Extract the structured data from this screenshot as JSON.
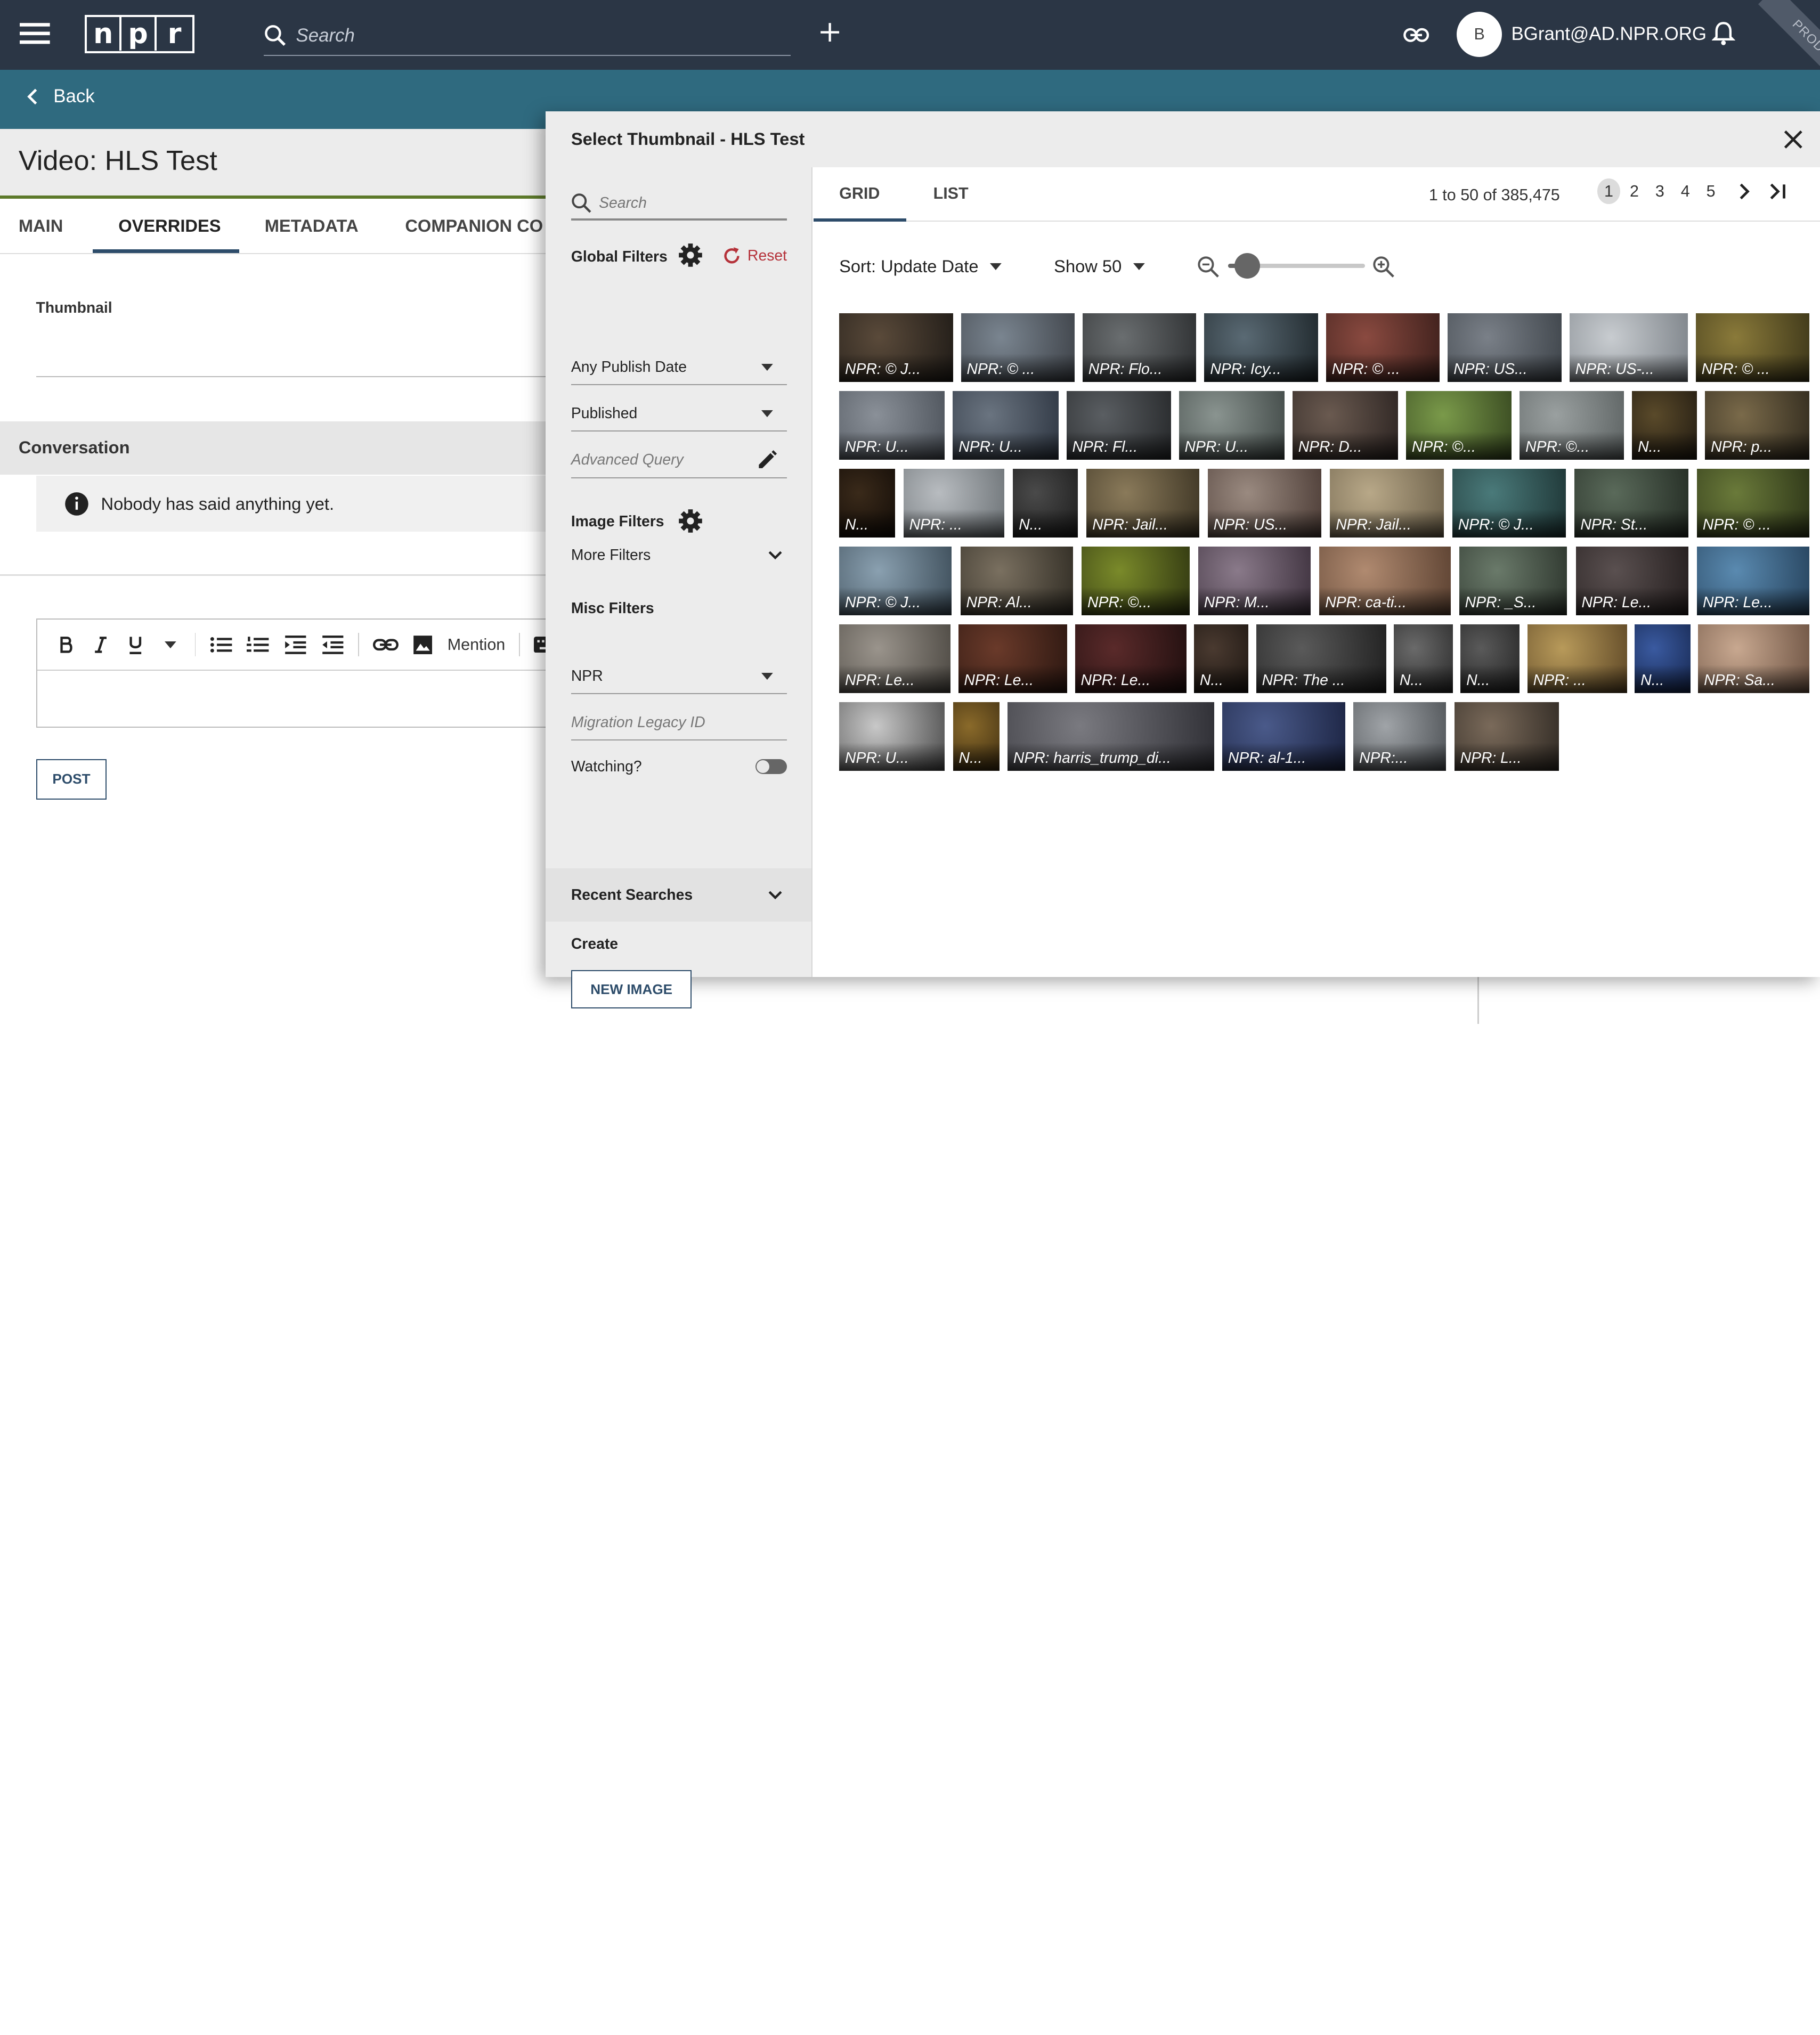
{
  "topbar": {
    "logo_letters": [
      "n",
      "p",
      "r"
    ],
    "search_placeholder": "Search",
    "avatar_initial": "B",
    "user_email": "BGrant@AD.NPR.ORG",
    "env_badge": "PROD",
    "bg_color": "#2b3645"
  },
  "backbar": {
    "back_label": "Back",
    "bg_color": "#2f6a7f"
  },
  "page": {
    "title": "Video: HLS Test",
    "tabs": [
      {
        "label": "MAIN"
      },
      {
        "label": "OVERRIDES",
        "active": true
      },
      {
        "label": "METADATA"
      },
      {
        "label": "COMPANION CO"
      }
    ],
    "thumbnail_label": "Thumbnail",
    "conversation_heading": "Conversation",
    "conversation_empty": "Nobody has said anything yet.",
    "editor_mention_label": "Mention",
    "post_label": "POST"
  },
  "modal": {
    "title": "Select Thumbnail - HLS Test",
    "filters": {
      "search_placeholder": "Search",
      "global_filters_heading": "Global Filters",
      "reset_label": "Reset",
      "publish_date_value": "Any Publish Date",
      "status_value": "Published",
      "advanced_query_placeholder": "Advanced Query",
      "image_filters_heading": "Image Filters",
      "more_filters_label": "More Filters",
      "misc_filters_heading": "Misc Filters",
      "source_value": "NPR",
      "migration_placeholder": "Migration Legacy ID",
      "watching_label": "Watching?",
      "watching_on": false,
      "recent_searches_label": "Recent Searches",
      "create_heading": "Create",
      "new_image_label": "NEW IMAGE"
    },
    "view_tabs": [
      {
        "label": "GRID",
        "active": true
      },
      {
        "label": "LIST"
      }
    ],
    "range_text": "1 to 50 of 385,475",
    "pages": [
      "1",
      "2",
      "3",
      "4",
      "5"
    ],
    "current_page": "1",
    "sort_label": "Sort: Update Date",
    "show_label": "Show 50",
    "zoom_level": 0.14,
    "accent_color": "#2d4c6a",
    "grid_rows": [
      [
        {
          "caption": "NPR: © J...",
          "c1": "#5a4a3a",
          "c2": "#1e1a16"
        },
        {
          "caption": "NPR: © ...",
          "c1": "#7a8590",
          "c2": "#3c4046"
        },
        {
          "caption": "NPR: Flo...",
          "c1": "#6a6e70",
          "c2": "#2a2c2e"
        },
        {
          "caption": "NPR: Icy...",
          "c1": "#5a6a74",
          "c2": "#1c2428"
        },
        {
          "caption": "NPR: © ...",
          "c1": "#8a4a40",
          "c2": "#3a1e1a"
        },
        {
          "caption": "NPR: US...",
          "c1": "#7a8088",
          "c2": "#3c4248"
        },
        {
          "caption": "NPR: US-...",
          "c1": "#c8ccd0",
          "c2": "#7a8086"
        },
        {
          "caption": "NPR: © ...",
          "c1": "#8a7a3a",
          "c2": "#3a3418"
        }
      ],
      [
        {
          "caption": "NPR: U...",
          "c1": "#8a9098",
          "c2": "#4a5058"
        },
        {
          "caption": "NPR: U...",
          "c1": "#6a7480",
          "c2": "#2c3440"
        },
        {
          "caption": "NPR: Fl...",
          "c1": "#5a5e62",
          "c2": "#242628"
        },
        {
          "caption": "NPR: U...",
          "c1": "#8a9490",
          "c2": "#3e4644"
        },
        {
          "caption": "NPR: D...",
          "c1": "#6a5a50",
          "c2": "#2a2220"
        },
        {
          "caption": "NPR: ©...",
          "c1": "#7a9a4a",
          "c2": "#34441e"
        },
        {
          "caption": "NPR: ©...",
          "c1": "#9aa0a0",
          "c2": "#5a6060"
        },
        {
          "caption": "N...",
          "c1": "#5a4a2a",
          "c2": "#1e1810"
        },
        {
          "caption": "NPR: p...",
          "c1": "#7a6a4a",
          "c2": "#2e281c"
        }
      ],
      [
        {
          "caption": "N...",
          "c1": "#3a2a1a",
          "c2": "#100a06"
        },
        {
          "caption": "NPR: ...",
          "c1": "#b8bcc0",
          "c2": "#6a7074"
        },
        {
          "caption": "N...",
          "c1": "#4a4a4a",
          "c2": "#1a1a1a"
        },
        {
          "caption": "NPR: Jail...",
          "c1": "#8a7a5a",
          "c2": "#3a3222"
        },
        {
          "caption": "NPR: US...",
          "c1": "#9a8a80",
          "c2": "#4a3a34"
        },
        {
          "caption": "NPR: Jail...",
          "c1": "#b8a888",
          "c2": "#6a5e48"
        },
        {
          "caption": "NPR: © J...",
          "c1": "#4a7a7a",
          "c2": "#1c3232"
        },
        {
          "caption": "NPR: St...",
          "c1": "#5a6a5a",
          "c2": "#222a22"
        },
        {
          "caption": "NPR: © ...",
          "c1": "#6a7a3a",
          "c2": "#2a3216"
        }
      ],
      [
        {
          "caption": "NPR: © J...",
          "c1": "#8aa0b0",
          "c2": "#3a4a56"
        },
        {
          "caption": "NPR: Al...",
          "c1": "#7a7060",
          "c2": "#2e2a22"
        },
        {
          "caption": "NPR: ©...",
          "c1": "#7a8a2a",
          "c2": "#2e3410"
        },
        {
          "caption": "NPR: M...",
          "c1": "#8a7a8a",
          "c2": "#3a2e3a"
        },
        {
          "caption": "NPR: ca-ti...",
          "c1": "#b08a70",
          "c2": "#5a4030"
        },
        {
          "caption": "NPR: _S...",
          "c1": "#6a7a6a",
          "c2": "#2a322a"
        },
        {
          "caption": "NPR: Le...",
          "c1": "#5a5050",
          "c2": "#221c1c"
        },
        {
          "caption": "NPR: Le...",
          "c1": "#5a8ab0",
          "c2": "#24405a"
        }
      ],
      [
        {
          "caption": "NPR: Le...",
          "c1": "#9a948c",
          "c2": "#4a4640"
        },
        {
          "caption": "NPR: Le...",
          "c1": "#6a3a2a",
          "c2": "#2a1610"
        },
        {
          "caption": "NPR: Le...",
          "c1": "#5a2a2a",
          "c2": "#1e0e0e"
        },
        {
          "caption": "N...",
          "c1": "#4a3a30",
          "c2": "#1a1410"
        },
        {
          "caption": "NPR: The ...",
          "c1": "#5a5a5a",
          "c2": "#1e1e1e"
        },
        {
          "caption": "N...",
          "c1": "#6a6a6a",
          "c2": "#262626"
        },
        {
          "caption": "N...",
          "c1": "#5a5a5a",
          "c2": "#202020"
        },
        {
          "caption": "NPR: ...",
          "c1": "#b89a5a",
          "c2": "#5a4424"
        },
        {
          "caption": "N...",
          "c1": "#3a5aa0",
          "c2": "#14244a"
        },
        {
          "caption": "NPR: Sa...",
          "c1": "#c8a890",
          "c2": "#6a5040"
        }
      ],
      [
        {
          "caption": "NPR: U...",
          "c1": "#c8c8c8",
          "c2": "#4a4a4a"
        },
        {
          "caption": "N...",
          "c1": "#8a6a2a",
          "c2": "#3a2a10"
        },
        {
          "caption": "NPR: harris_trump_di...",
          "c1": "#7a7a80",
          "c2": "#2e2e34"
        },
        {
          "caption": "NPR: al-1...",
          "c1": "#4a5a8a",
          "c2": "#1a2240"
        },
        {
          "caption": "NPR:...",
          "c1": "#a0a4a8",
          "c2": "#4a4e52"
        },
        {
          "caption": "NPR: L...",
          "c1": "#7a6a5a",
          "c2": "#2e2822"
        }
      ]
    ]
  }
}
